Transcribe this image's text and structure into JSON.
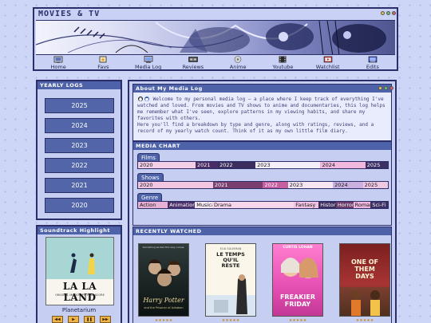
{
  "site": {
    "title": "MOVIES & TV"
  },
  "nav": [
    {
      "label": "Home",
      "icon": "home-icon"
    },
    {
      "label": "Favs",
      "icon": "favs-icon"
    },
    {
      "label": "Media Log",
      "icon": "media-log-icon"
    },
    {
      "label": "Reviews",
      "icon": "reviews-icon"
    },
    {
      "label": "Anime",
      "icon": "anime-icon"
    },
    {
      "label": "Youtube",
      "icon": "youtube-icon"
    },
    {
      "label": "Watchlist",
      "icon": "watchlist-icon"
    },
    {
      "label": "Edits",
      "icon": "edits-icon"
    }
  ],
  "yearly": {
    "title": "YEARLY LOGS",
    "years": [
      "2025",
      "2024",
      "2023",
      "2022",
      "2021",
      "2020"
    ]
  },
  "soundtrack": {
    "title": "Soundtrack Highlight",
    "album_title": "LA LA LAND",
    "album_subtitle": "ORIGINAL MOTION PICTURE SCORE",
    "track": "Planetarium"
  },
  "about": {
    "title": "About My Media Log",
    "intro": "Welcome to my personal media log — a place where I keep track of everything I've watched and loved. From movies and TV shows to anime and documentaries, this log helps me remember what I've seen, explore patterns in my viewing habits, and share my favorites with others.",
    "details": "Here you'll find a breakdown by type and genre, along with ratings, reviews, and a record of my yearly watch count. Think of it as my own little film diary."
  },
  "chart": {
    "title": "MEDIA CHART",
    "films_label": "Films",
    "shows_label": "Shows",
    "genre_label": "Genre",
    "films": [
      {
        "label": "2020",
        "share": 0.23,
        "color": "#f2cfe6"
      },
      {
        "label": "2021",
        "share": 0.09,
        "color": "#4a2c66"
      },
      {
        "label": "2022",
        "share": 0.15,
        "color": "#3b2e5f"
      },
      {
        "label": "2023",
        "share": 0.26,
        "color": "#f4eef8"
      },
      {
        "label": "2024",
        "share": 0.18,
        "color": "#f0b8dc"
      },
      {
        "label": "2025",
        "share": 0.09,
        "color": "#3c2f66"
      }
    ],
    "shows": [
      {
        "label": "2020",
        "share": 0.3,
        "color": "#f2c6e0"
      },
      {
        "label": "2021",
        "share": 0.2,
        "color": "#7a3e6e"
      },
      {
        "label": "2022",
        "share": 0.1,
        "color": "#c65ea0"
      },
      {
        "label": "2023",
        "share": 0.18,
        "color": "#f6e6f2"
      },
      {
        "label": "2024",
        "share": 0.12,
        "color": "#c9b0de"
      },
      {
        "label": "2025",
        "share": 0.1,
        "color": "#f1c8e4"
      }
    ],
    "genres": [
      {
        "label": "Action",
        "share": 0.12,
        "color": "#e8b0d4"
      },
      {
        "label": "Animation",
        "share": 0.11,
        "color": "#4b2f68"
      },
      {
        "label": "Musical",
        "share": 0.07,
        "color": "#f7e8f3"
      },
      {
        "label": "Drama",
        "share": 0.33,
        "color": "#f8d6ec"
      },
      {
        "label": "Fantasy",
        "share": 0.1,
        "color": "#f3c3e2"
      },
      {
        "label": "Historical",
        "share": 0.07,
        "color": "#3b2d5e"
      },
      {
        "label": "Horror",
        "share": 0.07,
        "color": "#6a3b69"
      },
      {
        "label": "Romance",
        "share": 0.07,
        "color": "#f0b6dc"
      },
      {
        "label": "Sci-Fi",
        "share": 0.07,
        "color": "#3d2f62"
      }
    ]
  },
  "recent": {
    "title": "RECENTLY WATCHED",
    "items": [
      {
        "title": "Harry Potter",
        "subtitle": "and the Prisoner of Azkaban",
        "top": "Something wicked this way comes."
      },
      {
        "title": "LE TEMPS QU'IL RESTE",
        "top": "ELIA SULEIMAN"
      },
      {
        "title": "FREAKIER FRIDAY",
        "top": "CURTIS  LOHAN"
      },
      {
        "title": "ONE OF THEM DAYS"
      }
    ]
  },
  "colors": {
    "accent": "#4d62a8",
    "border": "#2b2e69",
    "button": "#5265a8",
    "background": "#cdd6f6"
  }
}
